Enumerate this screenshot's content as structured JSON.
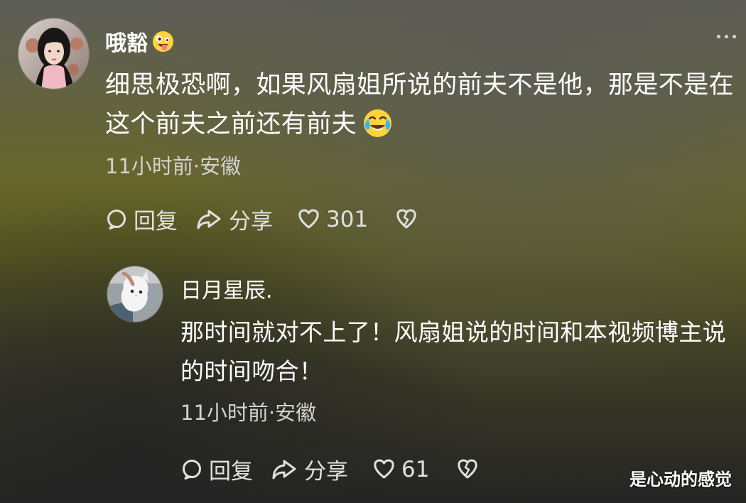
{
  "comments": [
    {
      "username": "哦豁",
      "username_emoji_icon": "crazy-face-emoji",
      "text": "细思极恐啊，如果风扇姐所说的前夫不是他，那是不是在这个前夫之前还有前夫",
      "text_emoji_icon": "crying-laughing-emoji",
      "meta": "11小时前·安徽",
      "reply_label": "回复",
      "share_label": "分享",
      "like_count": "301"
    },
    {
      "username": "日月星辰.",
      "text": "那时间就对不上了！风扇姐说的时间和本视频博主说的时间吻合！",
      "meta": "11小时前·安徽",
      "reply_label": "回复",
      "share_label": "分享",
      "like_count": "61"
    }
  ],
  "watermark": "是心动的感觉",
  "icons": {
    "reply": "comment-bubble-icon",
    "share": "share-arrow-icon",
    "like": "heart-icon",
    "dislike": "broken-heart-icon",
    "more": "more-dots-icon"
  },
  "colors": {
    "background_top": "#5d5d58",
    "background_mid": "#67672b",
    "background_bottom": "#242424",
    "text": "#ffffff",
    "meta_text": "#d2d2d2"
  }
}
